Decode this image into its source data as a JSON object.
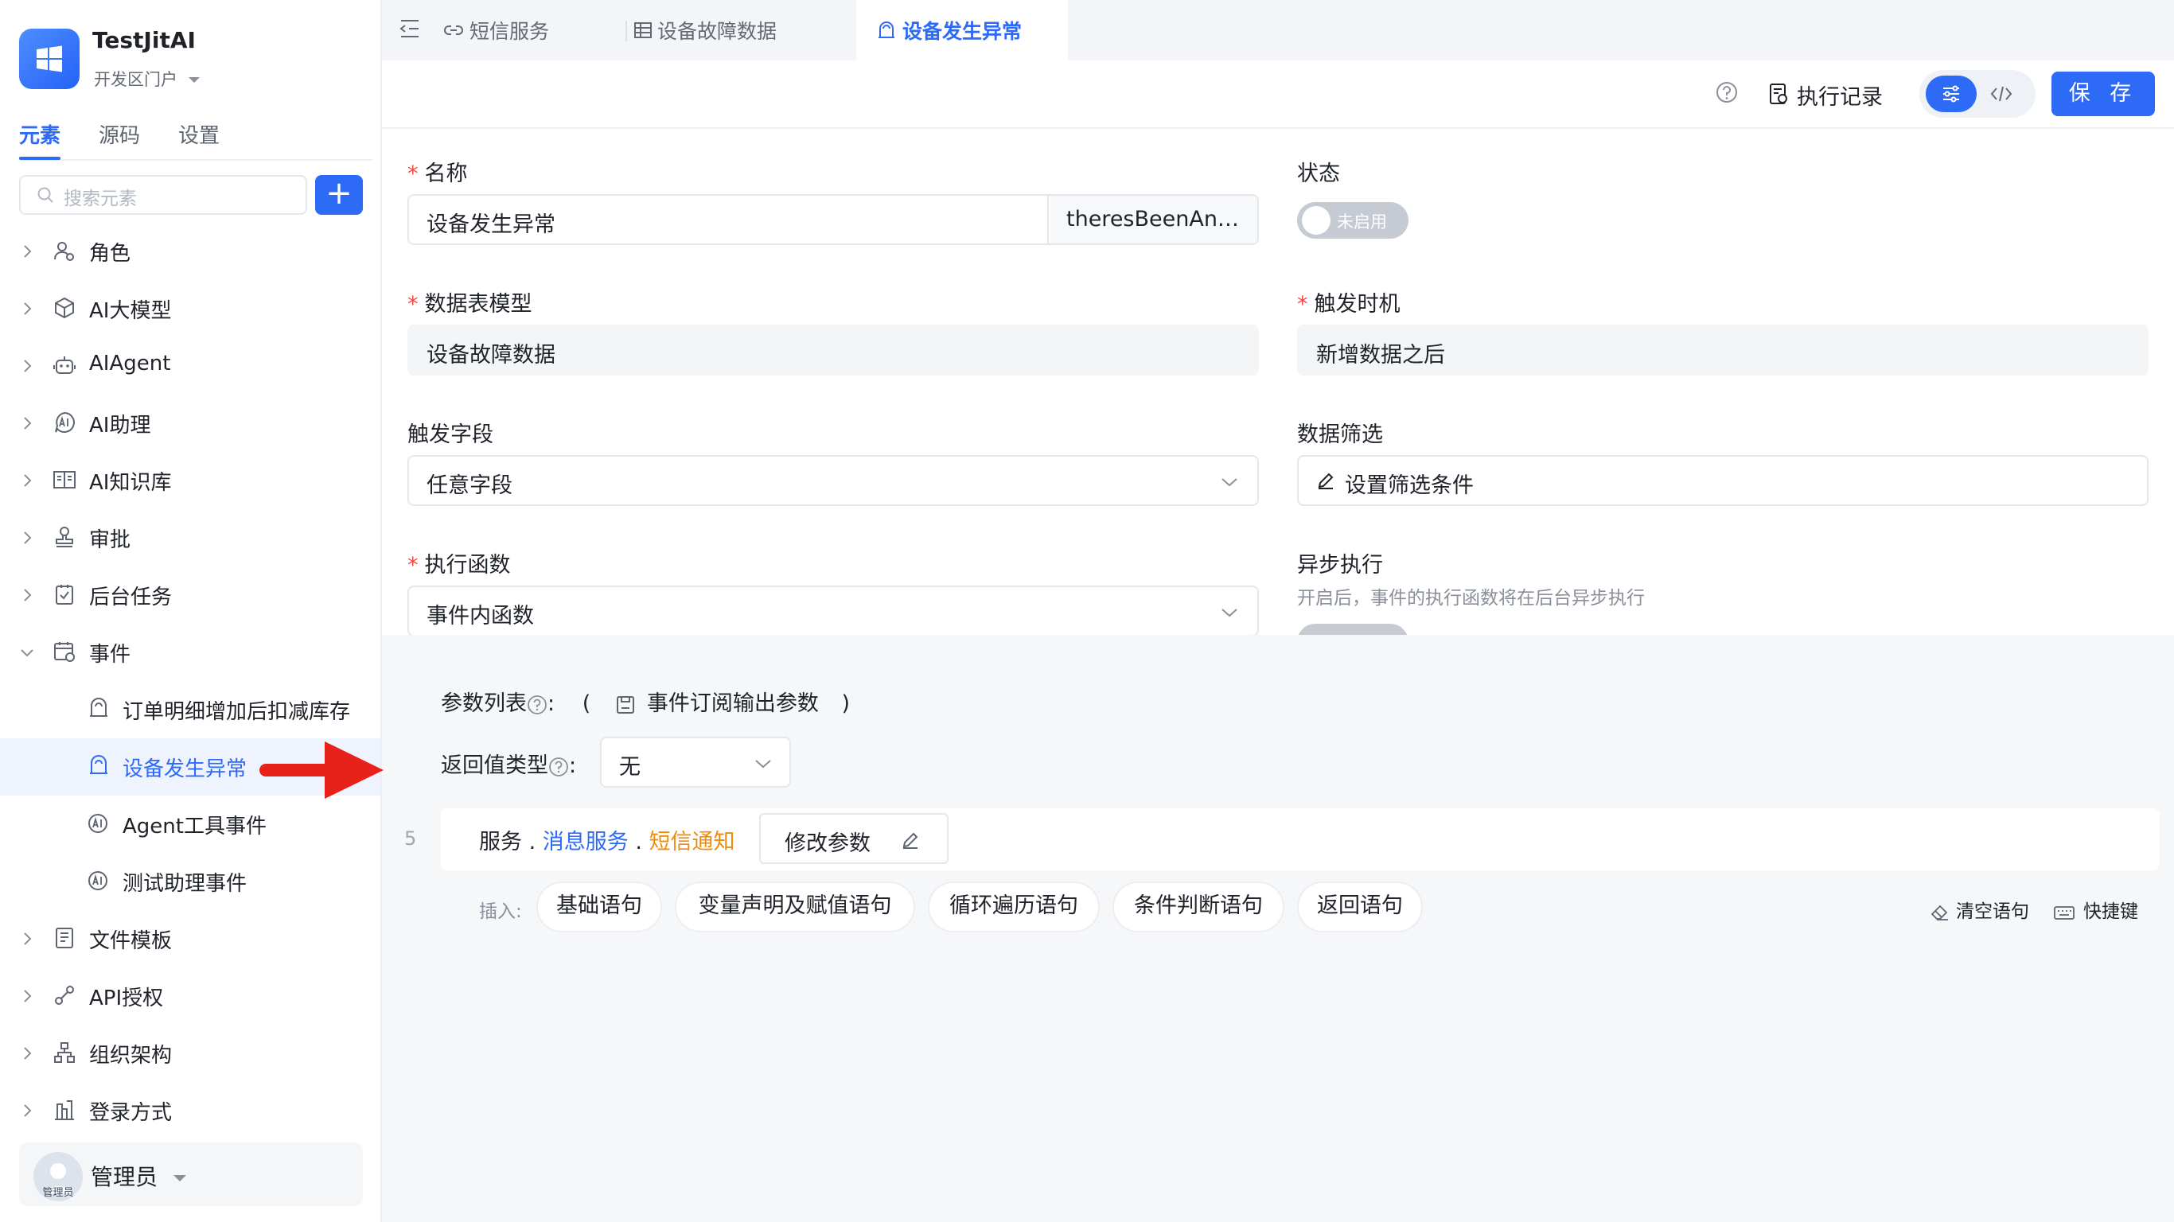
{
  "app": {
    "name": "TestJitAI",
    "subtitle": "开发区门户"
  },
  "sidebar": {
    "tabs": [
      "元素",
      "源码",
      "设置"
    ],
    "active_tab": 0,
    "search_placeholder": "搜索元素",
    "add_label": "+",
    "items": [
      {
        "label": "角色",
        "icon": "roles-icon"
      },
      {
        "label": "AI大模型",
        "icon": "cube-icon"
      },
      {
        "label": "AIAgent",
        "icon": "robot-icon"
      },
      {
        "label": "AI助理",
        "icon": "ai-assistant-icon"
      },
      {
        "label": "AI知识库",
        "icon": "book-icon"
      },
      {
        "label": "审批",
        "icon": "stamp-icon"
      },
      {
        "label": "后台任务",
        "icon": "task-icon"
      },
      {
        "label": "事件",
        "icon": "event-icon",
        "expanded": true
      }
    ],
    "event_children": [
      {
        "label": "订单明细增加后扣减库存",
        "icon": "event-trigger-icon"
      },
      {
        "label": "设备发生异常",
        "icon": "event-trigger-icon",
        "selected": true
      },
      {
        "label": "Agent工具事件",
        "icon": "ai-event-icon"
      },
      {
        "label": "测试助理事件",
        "icon": "ai-event-icon"
      }
    ],
    "items_after": [
      {
        "label": "文件模板",
        "icon": "file-icon"
      },
      {
        "label": "API授权",
        "icon": "link-icon"
      },
      {
        "label": "组织架构",
        "icon": "org-icon"
      },
      {
        "label": "登录方式",
        "icon": "login-icon"
      }
    ],
    "user": {
      "name": "管理员",
      "avatar_text": "管理员"
    }
  },
  "topbar": {
    "tabs": [
      {
        "label": "短信服务",
        "icon": "link-icon"
      },
      {
        "label": "设备故障数据",
        "icon": "table-icon"
      },
      {
        "label": "设备发生异常",
        "icon": "event-trigger-icon",
        "active": true
      }
    ]
  },
  "toolbar": {
    "exec_record": "执行记录",
    "save": "保 存"
  },
  "form": {
    "name_label": "名称",
    "name_value": "设备发生异常",
    "name_code": "theresBeenAn…",
    "status_label": "状态",
    "status_value": "未启用",
    "model_label": "数据表模型",
    "model_value": "设备故障数据",
    "trigger_label": "触发时机",
    "trigger_value": "新增数据之后",
    "field_label": "触发字段",
    "field_value": "任意字段",
    "filter_label": "数据筛选",
    "filter_value": "设置筛选条件",
    "func_label": "执行函数",
    "func_value": "事件内函数",
    "async_label": "异步执行",
    "async_hint": "开启后，事件的执行函数将在后台异步执行"
  },
  "editor": {
    "params_label": "参数列表",
    "params_colon": ":",
    "params_open": "(",
    "params_value": "事件订阅输出参数",
    "params_close": ")",
    "return_label": "返回值类型",
    "return_colon": ":",
    "return_value": "无",
    "line_no": "5",
    "stmt": {
      "part1": "服务",
      "dot1": ".",
      "part2": "消息服务",
      "dot2": ".",
      "part3": "短信通知"
    },
    "modify_params": "修改参数",
    "insert_label": "插入:",
    "insert_chips": [
      "基础语句",
      "变量声明及赋值语句",
      "循环遍历语句",
      "条件判断语句",
      "返回语句"
    ],
    "clear_label": "清空语句",
    "shortcut_label": "快捷键"
  },
  "colors": {
    "accent": "#2d6af6",
    "service_blue": "#2d6af6",
    "sms_orange": "#f08c0a",
    "arrow_red": "#e8221b"
  }
}
